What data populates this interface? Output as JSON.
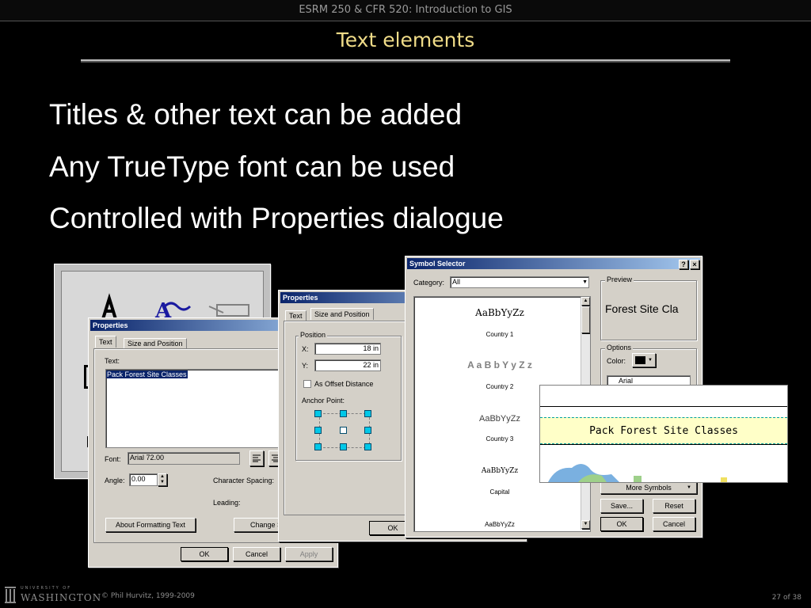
{
  "header": {
    "course": "ESRM 250 & CFR 520: Introduction to GIS",
    "title": "Text elements"
  },
  "bullets": [
    "Titles & other text can be added",
    "Any TrueType font can be used",
    "Controlled with Properties dialogue"
  ],
  "footer": {
    "logo_top": "UNIVERSITY OF",
    "logo_bottom": "WASHINGTON",
    "copyright": "© Phil Hurvitz, 1999-2009",
    "page": "27 of 38"
  },
  "colors": {
    "title": "#f0dc88",
    "titlebar_start": "#0a246a",
    "titlebar_end": "#a6caf0",
    "handle": "#00c8e8",
    "banner": "#ffffc8"
  },
  "props1": {
    "title": "Properties",
    "tabs": [
      "Text",
      "Size and Position"
    ],
    "text_label": "Text:",
    "text_value": "Pack Forest Site Classes",
    "font_label": "Font:",
    "font_value": "Arial 72.00",
    "angle_label": "Angle:",
    "angle_value": "0.00",
    "char_spacing_label": "Character Spacing:",
    "leading_label": "Leading:",
    "about_button": "About Formatting Text",
    "change_button": "Change S",
    "ok": "OK",
    "cancel": "Cancel",
    "apply": "Apply"
  },
  "props2": {
    "title": "Properties",
    "tabs": [
      "Text",
      "Size and Position"
    ],
    "position_group": "Position",
    "x_label": "X:",
    "x_value": "18 in",
    "y_label": "Y:",
    "y_value": "22 in",
    "offset_label": "As Offset Distance",
    "anchor_label": "Anchor Point:",
    "ok": "OK"
  },
  "symbol_selector": {
    "title": "Symbol Selector",
    "help_glyph": "?",
    "close_glyph": "×",
    "category_label": "Category:",
    "category_value": "All",
    "preview_label": "Preview",
    "preview_text": "Forest Site Cla",
    "options_label": "Options",
    "color_label": "Color:",
    "font_value": "Arial",
    "symbols": [
      {
        "sample": "AaBbYyZz",
        "name": "Country 1"
      },
      {
        "sample": "A a B b Y y Z z",
        "name": "Country 2"
      },
      {
        "sample": "AaBbYyZz",
        "name": "Country 3"
      },
      {
        "sample": "AaBbYyZz",
        "name": "Capital"
      },
      {
        "sample": "AaBbYyZz",
        "name": ""
      }
    ],
    "more_symbols": "More Symbols",
    "save": "Save...",
    "reset": "Reset",
    "ok": "OK",
    "cancel": "Cancel"
  },
  "map_preview": {
    "banner": "Pack Forest Site Classes"
  }
}
